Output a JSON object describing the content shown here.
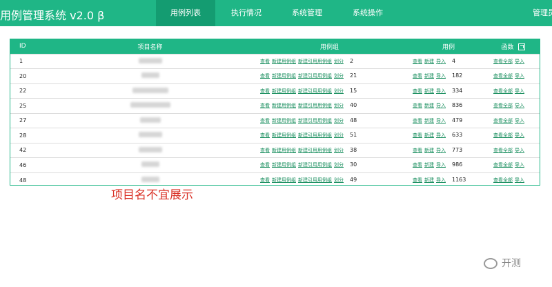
{
  "header": {
    "app_title": "用例管理系统 v2.0 β",
    "nav": [
      "用例列表",
      "执行情况",
      "系统管理",
      "系统操作"
    ],
    "user_label": "管理员"
  },
  "colors": {
    "accent": "#1fb686",
    "accent_dark": "#149c71",
    "link": "#1a8f5f",
    "note": "#d93025"
  },
  "table": {
    "columns": [
      "ID",
      "项目名称",
      "用例组",
      "用例",
      "函数"
    ],
    "group_actions": [
      "查看",
      "新建用例组",
      "新建引用用例组",
      "划分"
    ],
    "case_actions": [
      "查看",
      "新建",
      "导入"
    ],
    "func_actions": [
      "查看全部",
      "导入"
    ],
    "rows": [
      {
        "id": "1",
        "groups": "2",
        "cases": "4"
      },
      {
        "id": "20",
        "groups": "21",
        "cases": "182"
      },
      {
        "id": "22",
        "groups": "15",
        "cases": "334"
      },
      {
        "id": "25",
        "groups": "40",
        "cases": "836"
      },
      {
        "id": "27",
        "groups": "48",
        "cases": "479"
      },
      {
        "id": "28",
        "groups": "51",
        "cases": "633"
      },
      {
        "id": "42",
        "groups": "38",
        "cases": "773"
      },
      {
        "id": "46",
        "groups": "30",
        "cases": "986"
      },
      {
        "id": "48",
        "groups": "49",
        "cases": "1163"
      }
    ]
  },
  "annotation": "项目名不宜展示",
  "watermark": "开测"
}
